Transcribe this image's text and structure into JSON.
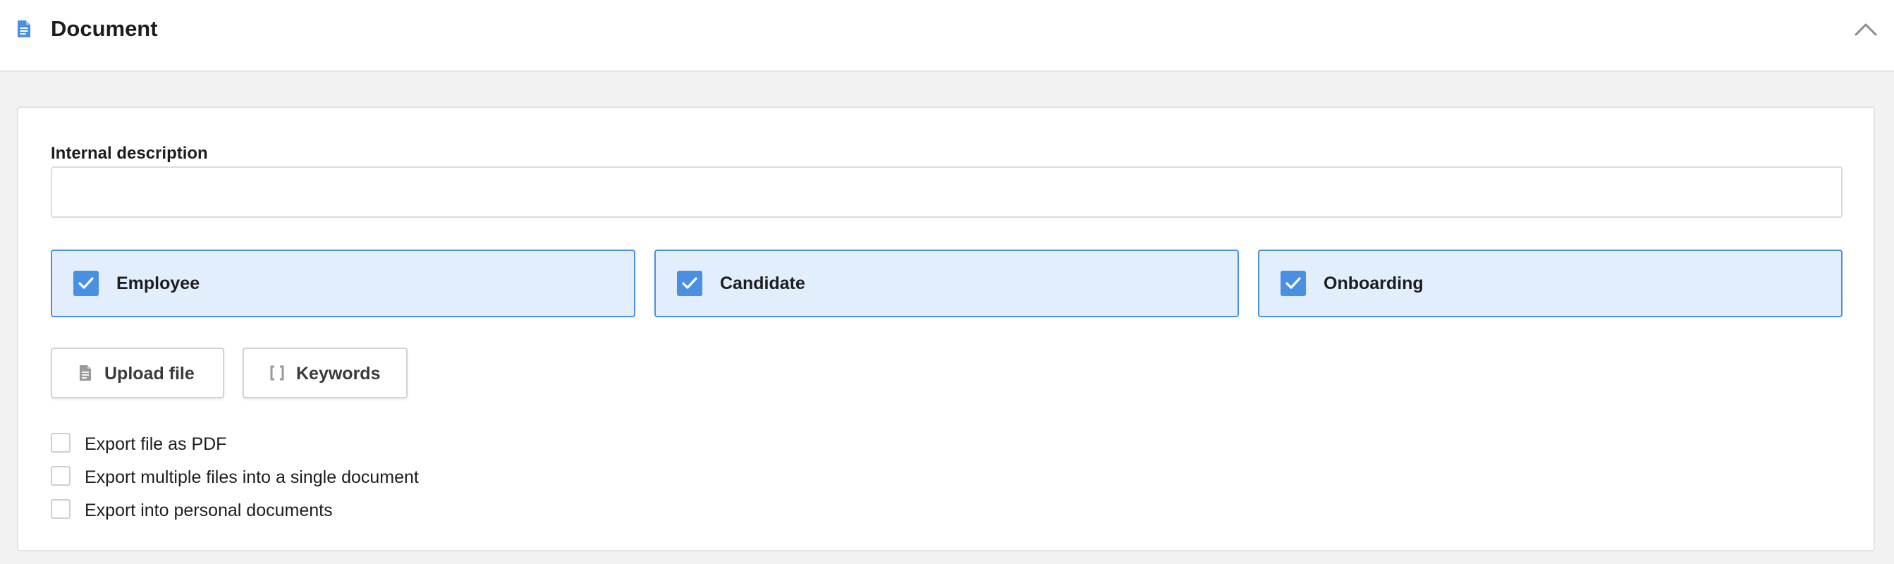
{
  "header": {
    "title": "Document",
    "icon": "document-icon",
    "collapse_icon": "chevron-up-icon",
    "accent_color": "#4a90e2"
  },
  "form": {
    "description_label": "Internal description",
    "description_value": "",
    "description_placeholder": ""
  },
  "audiences": [
    {
      "label": "Employee",
      "checked": true
    },
    {
      "label": "Candidate",
      "checked": true
    },
    {
      "label": "Onboarding",
      "checked": true
    }
  ],
  "actions": {
    "upload_label": "Upload file",
    "upload_icon": "file-icon",
    "keywords_label": "Keywords",
    "keywords_icon": "brackets-icon"
  },
  "options": [
    {
      "label": "Export file as PDF",
      "checked": false
    },
    {
      "label": "Export multiple files into a single document",
      "checked": false
    },
    {
      "label": "Export into personal documents",
      "checked": false
    }
  ],
  "colors": {
    "accent": "#4a90e2",
    "selected_bg": "#e3eefd",
    "page_bg": "#f2f2f2"
  }
}
